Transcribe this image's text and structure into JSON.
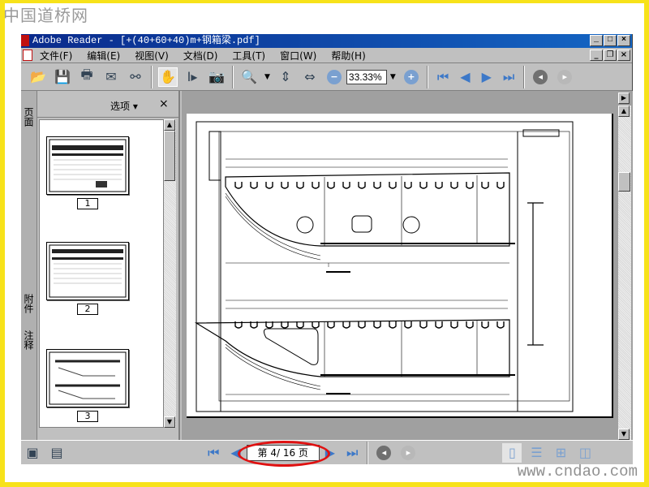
{
  "watermark": {
    "top_left": "中国道桥网",
    "bottom_right": "www.cndao.com"
  },
  "window": {
    "title": "Adobe Reader - [+(40+60+40)m+钢箱梁.pdf]"
  },
  "menu": [
    "文件(F)",
    "编辑(E)",
    "视图(V)",
    "文档(D)",
    "工具(T)",
    "窗口(W)",
    "帮助(H)"
  ],
  "toolbar": {
    "zoom_value": "33.33%"
  },
  "nav_panel": {
    "tabs": [
      "页面",
      "附件",
      "注释"
    ],
    "options_label": "选项 ▾",
    "close": "×",
    "thumbnails": [
      "1",
      "2",
      "3"
    ]
  },
  "status": {
    "page_label": "第 4/ 16 页",
    "current_page": 4,
    "total_pages": 16
  },
  "colors": {
    "title_bar": "#0a2a8c",
    "highlight_ring": "#e01010",
    "frame": "#f7e21a"
  }
}
